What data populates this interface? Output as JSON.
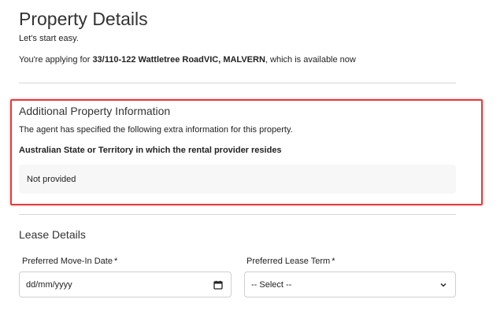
{
  "header": {
    "title": "Property Details",
    "subtitle": "Let's start easy.",
    "applying_prefix": "You're applying for ",
    "address": "33/110-122 Wattletree RoadVIC, MALVERN",
    "applying_suffix": ", which is available now"
  },
  "additional_info": {
    "heading": "Additional Property Information",
    "description": "The agent has specified the following extra information for this property.",
    "question": "Australian State or Territory in which the rental provider resides",
    "answer": "Not provided",
    "highlight_color": "#e8393a"
  },
  "lease": {
    "heading": "Lease Details",
    "move_in": {
      "label": "Preferred Move-In Date",
      "required_mark": "*",
      "placeholder": "dd/mm/yyyy",
      "icon": "calendar-icon"
    },
    "lease_term": {
      "label": "Preferred Lease Term",
      "required_mark": "*",
      "selected": "-- Select --",
      "icon": "chevron-down-icon"
    }
  }
}
